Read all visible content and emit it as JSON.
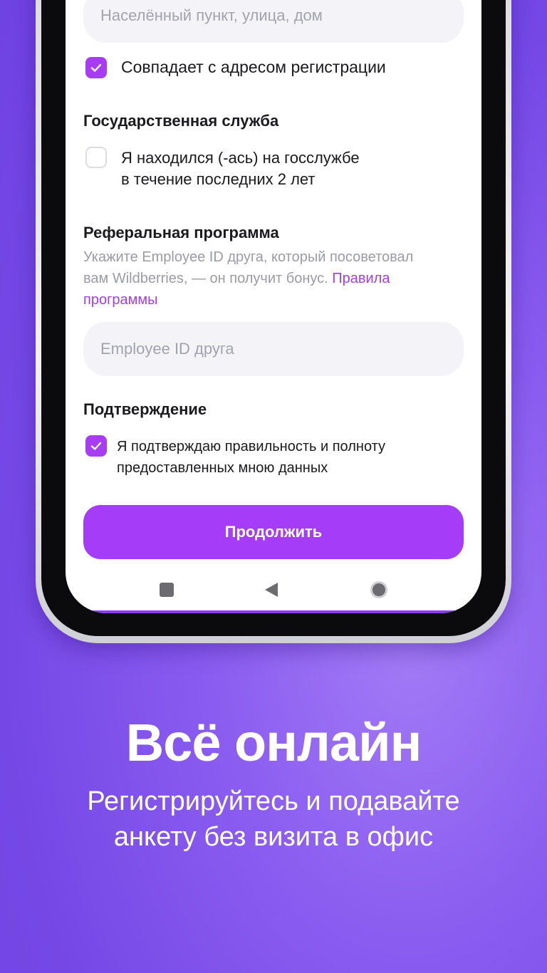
{
  "address_field": {
    "placeholder": "Населённый пункт, улица, дом"
  },
  "same_address": {
    "label": "Совпадает с адресом регистрации",
    "checked": true
  },
  "gov_service": {
    "heading": "Государственная служба",
    "checkbox_label_line1": "Я находился (-ась) на госслужбе",
    "checkbox_label_line2": "в течение последних 2 лет",
    "checked": false
  },
  "referral": {
    "heading": "Реферальная программа",
    "desc_line1": "Укажите Employee ID друга, который посоветовал",
    "desc_line2_prefix": "вам Wildberries, — он получит бонус.",
    "link_part1": "Правила",
    "link_part2": "программы",
    "input_placeholder": "Employee ID друга"
  },
  "confirmation": {
    "heading": "Подтверждение",
    "checkbox_label_line1": "Я подтверждаю правильность и полноту",
    "checkbox_label_line2": "предоставленных мною данных",
    "checked": true
  },
  "continue_button": {
    "label": "Продолжить"
  },
  "promo": {
    "title": "Всё онлайн",
    "subtitle_line1": "Регистрируйтесь и подавайте",
    "subtitle_line2": "анкету без визита в офис"
  },
  "colors": {
    "accent": "#a53cf8",
    "background": "#7a4de8"
  }
}
